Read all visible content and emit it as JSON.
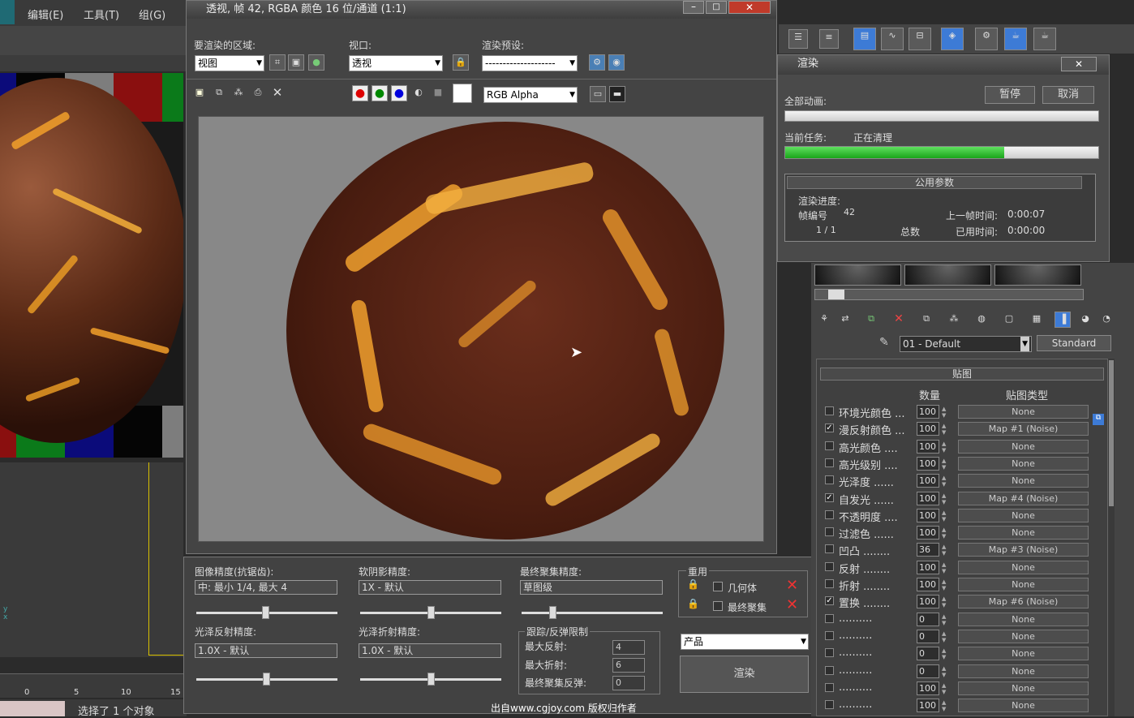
{
  "menu": {
    "edit": "编辑(E)",
    "tools": "工具(T)",
    "group": "组(G)"
  },
  "frame_window": {
    "title": "透视, 帧 42, RGBA 颜色 16 位/通道 (1:1)",
    "area_label": "要渲染的区域:",
    "area_value": "视图",
    "viewport_label": "视口:",
    "viewport_value": "透视",
    "preset_label": "渲染预设:",
    "preset_value": "--------------------",
    "channel_value": "RGB Alpha"
  },
  "quality_panel": {
    "aa_label": "图像精度(抗锯齿):",
    "aa_value": "中: 最小 1/4, 最大 4",
    "soft_label": "软阴影精度:",
    "soft_value": "1X - 默认",
    "fg_label": "最终聚集精度:",
    "fg_value": "草图级",
    "reuse_title": "重用",
    "geometry": "几何体",
    "final_gather": "最终聚集",
    "gloss_refl_label": "光泽反射精度:",
    "gloss_refl_value": "1.0X - 默认",
    "gloss_refr_label": "光泽折射精度:",
    "gloss_refr_value": "1.0X - 默认",
    "trace_title": "跟踪/反弹限制",
    "max_refl_label": "最大反射:",
    "max_refl_value": "4",
    "max_refr_label": "最大折射:",
    "max_refr_value": "6",
    "fg_bounce_label": "最终聚集反弹:",
    "fg_bounce_value": "0",
    "mode_value": "产品",
    "render_button": "渲染"
  },
  "render_dialog": {
    "title": "渲染",
    "all_anim": "全部动画:",
    "pause": "暂停",
    "cancel": "取消",
    "current_task_label": "当前任务:",
    "current_task_value": "正在清理",
    "progress_fraction": 0.7,
    "common_params": "公用参数",
    "progress_label": "渲染进度:",
    "frame_label": "帧编号",
    "frame_value": "42",
    "last_frame_label": "上一帧时间:",
    "last_frame_value": "0:00:07",
    "count": "1 / 1",
    "total_label": "总数",
    "elapsed_label": "已用时间:",
    "elapsed_value": "0:00:00"
  },
  "material": {
    "name": "01 - Default",
    "type": "Standard",
    "maps_title": "贴图",
    "amount_header": "数量",
    "maptype_header": "贴图类型",
    "rows": [
      {
        "name": "环境光颜色 ...",
        "checked": false,
        "amount": "100",
        "map": "None"
      },
      {
        "name": "漫反射颜色 ...",
        "checked": true,
        "amount": "100",
        "map": "Map #1  (Noise)"
      },
      {
        "name": "高光颜色 ....",
        "checked": false,
        "amount": "100",
        "map": "None"
      },
      {
        "name": "高光级别 ....",
        "checked": false,
        "amount": "100",
        "map": "None"
      },
      {
        "name": "光泽度 ......",
        "checked": false,
        "amount": "100",
        "map": "None"
      },
      {
        "name": "自发光 ......",
        "checked": true,
        "amount": "100",
        "map": "Map #4  (Noise)"
      },
      {
        "name": "不透明度 ....",
        "checked": false,
        "amount": "100",
        "map": "None"
      },
      {
        "name": "过滤色 ......",
        "checked": false,
        "amount": "100",
        "map": "None"
      },
      {
        "name": "凹凸 ........",
        "checked": false,
        "amount": "36",
        "map": "Map #3  (Noise)"
      },
      {
        "name": "反射 ........",
        "checked": false,
        "amount": "100",
        "map": "None"
      },
      {
        "name": "折射 ........",
        "checked": false,
        "amount": "100",
        "map": "None"
      },
      {
        "name": "置换 ........",
        "checked": true,
        "amount": "100",
        "map": "Map #6  (Noise)"
      },
      {
        "name": "..........",
        "checked": false,
        "amount": "0",
        "map": "None"
      },
      {
        "name": "..........",
        "checked": false,
        "amount": "0",
        "map": "None"
      },
      {
        "name": "..........",
        "checked": false,
        "amount": "0",
        "map": "None"
      },
      {
        "name": "..........",
        "checked": false,
        "amount": "0",
        "map": "None"
      },
      {
        "name": "..........",
        "checked": false,
        "amount": "100",
        "map": "None"
      },
      {
        "name": "..........",
        "checked": false,
        "amount": "100",
        "map": "None"
      }
    ]
  },
  "timeline": {
    "ticks": [
      "0",
      "5",
      "10",
      "15"
    ]
  },
  "status": {
    "selected": "选择了 1 个对象"
  },
  "watermark": "出自www.cgjoy.com 版权归作者"
}
